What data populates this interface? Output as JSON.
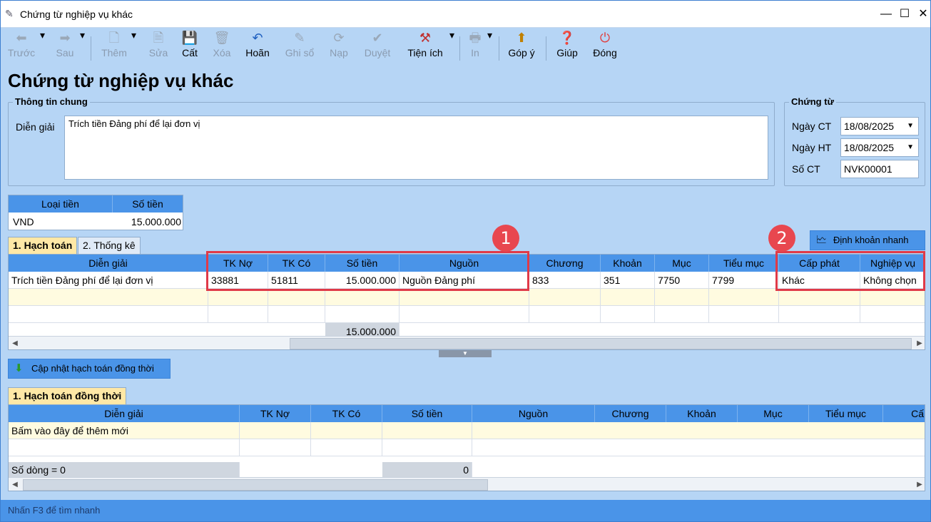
{
  "window": {
    "title": "Chứng từ nghiệp vụ khác"
  },
  "toolbar": {
    "items": [
      {
        "name": "truoc",
        "label": "Trước",
        "icon": "arrow-left-icon",
        "enabled": false
      },
      {
        "name": "sau",
        "label": "Sau",
        "icon": "arrow-right-icon",
        "enabled": false
      },
      {
        "name": "them",
        "label": "Thêm",
        "icon": "new-document-icon",
        "enabled": false
      },
      {
        "name": "sua",
        "label": "Sửa",
        "icon": "edit-document-icon",
        "enabled": false
      },
      {
        "name": "cat",
        "label": "Cất",
        "icon": "save-icon",
        "enabled": true
      },
      {
        "name": "xoa",
        "label": "Xóa",
        "icon": "delete-document-icon",
        "enabled": false
      },
      {
        "name": "hoan",
        "label": "Hoãn",
        "icon": "undo-icon",
        "enabled": true
      },
      {
        "name": "ghiso",
        "label": "Ghi sổ",
        "icon": "pencil-icon",
        "enabled": false
      },
      {
        "name": "nap",
        "label": "Nạp",
        "icon": "refresh-icon",
        "enabled": false
      },
      {
        "name": "duyet",
        "label": "Duyệt",
        "icon": "check-icon",
        "enabled": false
      },
      {
        "name": "tienich",
        "label": "Tiện ích",
        "icon": "tools-icon",
        "enabled": true
      },
      {
        "name": "in",
        "label": "In",
        "icon": "printer-icon",
        "enabled": false
      },
      {
        "name": "gopy",
        "label": "Góp ý",
        "icon": "feedback-icon",
        "enabled": true
      },
      {
        "name": "giup",
        "label": "Giúp",
        "icon": "help-icon",
        "enabled": true
      },
      {
        "name": "dong",
        "label": "Đóng",
        "icon": "power-icon",
        "enabled": true
      }
    ]
  },
  "page": {
    "title": "Chứng từ nghiệp vụ khác"
  },
  "info": {
    "group_title": "Thông tin chung",
    "dien_giai_label": "Diễn giải",
    "dien_giai_value": "Trích tiền Đảng phí để lại đơn vị"
  },
  "voucher": {
    "group_title": "Chứng từ",
    "ngay_ct_label": "Ngày CT",
    "ngay_ct_value": "18/08/2025",
    "ngay_ht_label": "Ngày HT",
    "ngay_ht_value": "18/08/2025",
    "so_ct_label": "Số CT",
    "so_ct_value": "NVK00001"
  },
  "currency": {
    "headers": [
      "Loại tiền",
      "Số tiền"
    ],
    "loai_tien": "VND",
    "so_tien": "15.000.000"
  },
  "tabs1": [
    {
      "label": "1. Hạch toán",
      "active": true
    },
    {
      "label": "2. Thống kê",
      "active": false
    }
  ],
  "quick_button": {
    "label": "Định khoản nhanh",
    "icon": "quick-entry-icon"
  },
  "grid1": {
    "headers": [
      "Diễn giải",
      "TK Nợ",
      "TK Có",
      "Số tiền",
      "Nguồn",
      "Chương",
      "Khoản",
      "Mục",
      "Tiểu mục",
      "Cấp phát",
      "Nghiệp vụ"
    ],
    "rows": [
      [
        "Trích tiền Đảng phí để lại đơn vị",
        "33881",
        "51811",
        "15.000.000",
        "Nguồn Đảng phí",
        "833",
        "351",
        "7750",
        "7799",
        "Khác",
        "Không chọn"
      ]
    ],
    "total": "15.000.000"
  },
  "markers": [
    "1",
    "2"
  ],
  "update_button": {
    "label": "Cập nhật hạch toán đồng thời",
    "icon": "arrow-down-green-icon"
  },
  "tabs2": [
    {
      "label": "1. Hạch toán đồng thời",
      "active": true
    }
  ],
  "grid2": {
    "headers": [
      "Diễn giải",
      "TK Nợ",
      "TK Có",
      "Số tiền",
      "Nguồn",
      "Chương",
      "Khoản",
      "Mục",
      "Tiểu mục",
      "Cấ"
    ],
    "placeholder_row": "Bấm vào đây để thêm mới",
    "footer_count": "Số dòng = 0",
    "footer_total": "0"
  },
  "status": {
    "text": "Nhấn F3 để tìm nhanh"
  }
}
